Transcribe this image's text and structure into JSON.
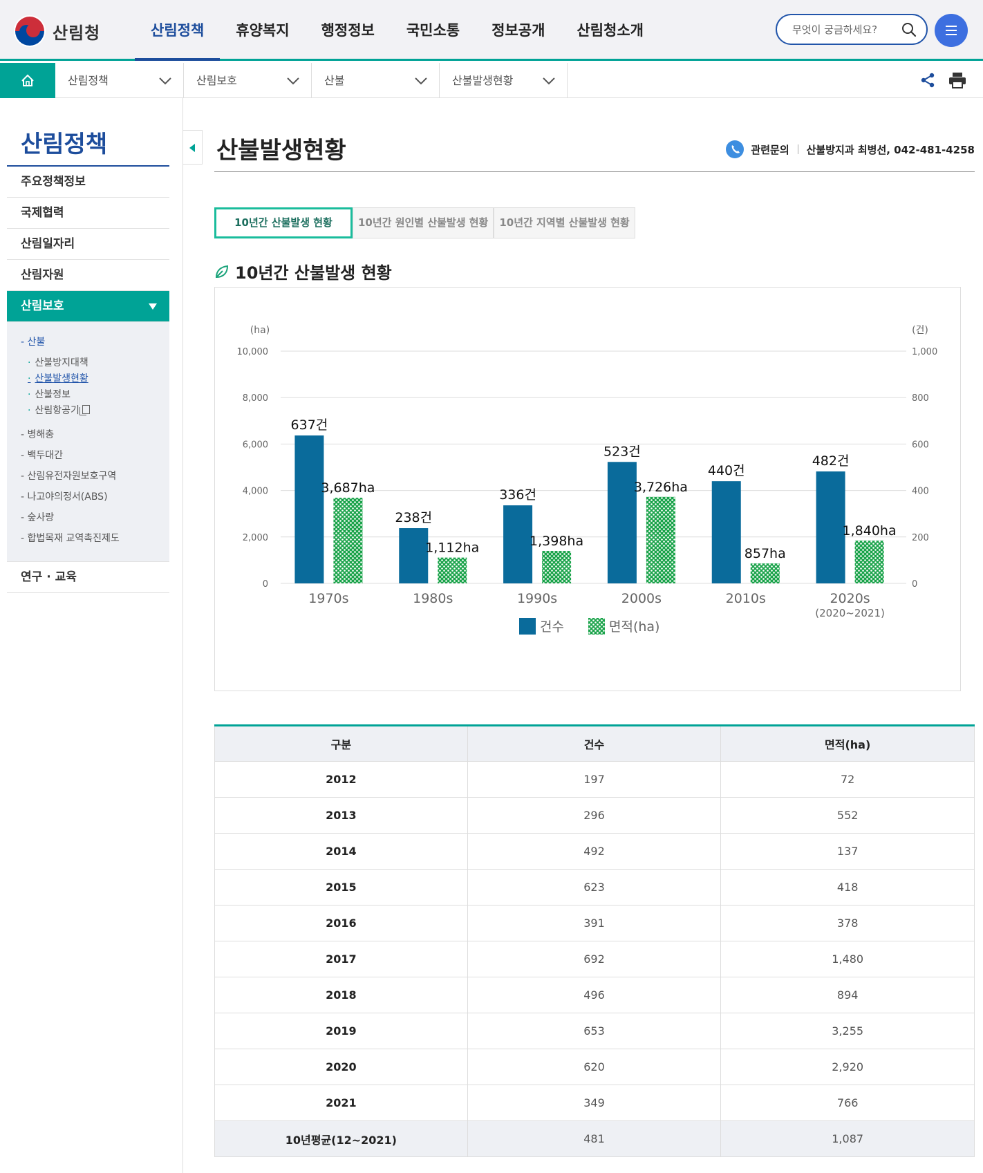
{
  "header": {
    "logo_text": "산림청",
    "gnb": [
      "산림정책",
      "휴양복지",
      "행정정보",
      "국민소통",
      "정보공개",
      "산림청소개"
    ],
    "search_placeholder": "무엇이 궁금하세요?"
  },
  "location": [
    "산림정책",
    "산림보호",
    "산불",
    "산불발생현황"
  ],
  "lnb": {
    "title": "산림정책",
    "items": [
      "주요정책정보",
      "국제협력",
      "산림일자리",
      "산림자원",
      "산림보호",
      "연구 · 교육"
    ],
    "sub": [
      "- 산불",
      "- 병해충",
      "- 백두대간",
      "- 산림유전자원보호구역",
      "- 나고야의정서(ABS)",
      "- 숲사랑",
      "- 합법목재 교역촉진제도"
    ],
    "sub2": [
      "산불방지대책",
      "산불발생현황",
      "산불정보",
      "산림항공기"
    ]
  },
  "page": {
    "title": "산불발생현황",
    "contact_label": "관련문의",
    "contact_value": "산불방지과 최병선, 042-481-4258",
    "tabs": [
      "10년간 산불발생 현황",
      "10년간 원인별 산불발생 현황",
      "10년간 지역별 산불발생 현황"
    ],
    "section_title": "10년간 산불발생 현황"
  },
  "chart_data": {
    "type": "bar",
    "categories": [
      "1970s",
      "1980s",
      "1990s",
      "2000s",
      "2010s",
      "2020s"
    ],
    "category_sublabels": [
      "",
      "",
      "",
      "",
      "",
      "(2020~2021)"
    ],
    "series": [
      {
        "name": "건수",
        "axis": "right",
        "values": [
          637,
          238,
          336,
          523,
          440,
          482
        ],
        "labels": [
          "637건",
          "238건",
          "336건",
          "523건",
          "440건",
          "482건"
        ],
        "color": "#0a6b9b"
      },
      {
        "name": "면적(ha)",
        "axis": "left",
        "values": [
          3687,
          1112,
          1398,
          3726,
          857,
          1840
        ],
        "labels": [
          "3,687ha",
          "1,112ha",
          "1,398ha",
          "3,726ha",
          "857ha",
          "1,840ha"
        ],
        "color": "#1aa34a"
      }
    ],
    "left_axis": {
      "unit": "(ha)",
      "ylim": [
        0,
        10000
      ],
      "ticks": [
        "0",
        "2,000",
        "4,000",
        "6,000",
        "8,000",
        "10,000"
      ]
    },
    "right_axis": {
      "unit": "(건)",
      "ylim": [
        0,
        1000
      ],
      "ticks": [
        "0",
        "200",
        "400",
        "600",
        "800",
        "1,000"
      ]
    },
    "grid": true,
    "legend": "bottom-center"
  },
  "table": {
    "headers": [
      "구분",
      "건수",
      "면적(ha)"
    ],
    "rows": [
      [
        "2012",
        "197",
        "72"
      ],
      [
        "2013",
        "296",
        "552"
      ],
      [
        "2014",
        "492",
        "137"
      ],
      [
        "2015",
        "623",
        "418"
      ],
      [
        "2016",
        "391",
        "378"
      ],
      [
        "2017",
        "692",
        "1,480"
      ],
      [
        "2018",
        "496",
        "894"
      ],
      [
        "2019",
        "653",
        "3,255"
      ],
      [
        "2020",
        "620",
        "2,920"
      ],
      [
        "2021",
        "349",
        "766"
      ]
    ],
    "avg": [
      "10년평균(12~2021)",
      "481",
      "1,087"
    ]
  }
}
